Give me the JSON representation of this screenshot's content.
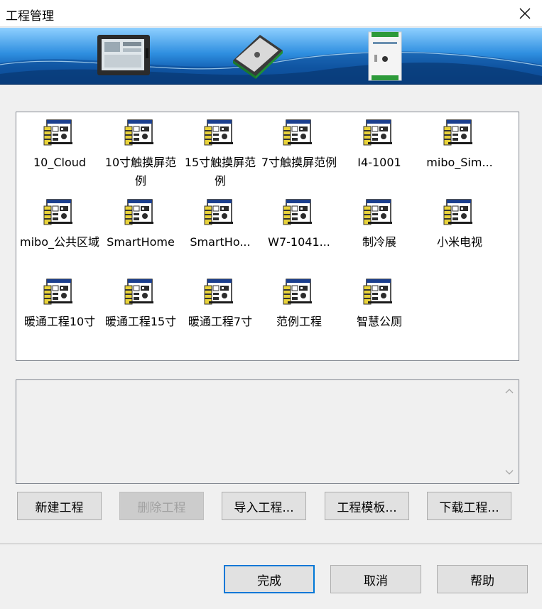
{
  "window": {
    "title": "工程管理"
  },
  "projects": [
    {
      "label": "10_Cloud"
    },
    {
      "label": "10寸触摸屏范例"
    },
    {
      "label": "15寸触摸屏范例"
    },
    {
      "label": "7寸触摸屏范例"
    },
    {
      "label": "I4-1001"
    },
    {
      "label": "mibo_Sim..."
    },
    {
      "label": "mibo_公共区域"
    },
    {
      "label": "SmartHome"
    },
    {
      "label": "SmartHo..."
    },
    {
      "label": "W7-1041..."
    },
    {
      "label": "制冷展"
    },
    {
      "label": "小米电视"
    },
    {
      "label": "暖通工程10寸"
    },
    {
      "label": "暖通工程15寸"
    },
    {
      "label": "暖通工程7寸"
    },
    {
      "label": "范例工程"
    },
    {
      "label": "智慧公厕"
    }
  ],
  "description": {
    "text": ""
  },
  "actions": {
    "new_project": "新建工程",
    "delete_project": "删除工程",
    "import_project": "导入工程...",
    "project_template": "工程模板...",
    "download_project": "下载工程..."
  },
  "footer": {
    "done": "完成",
    "cancel": "取消",
    "help": "帮助"
  },
  "icons": {
    "close": "close-icon",
    "project": "project-file-icon",
    "scroll_up": "chevron-up-icon",
    "scroll_down": "chevron-down-icon"
  },
  "colors": {
    "default_button_border": "#0078d7",
    "banner_top": "#8fd0ff",
    "banner_bottom": "#0e4c98"
  }
}
